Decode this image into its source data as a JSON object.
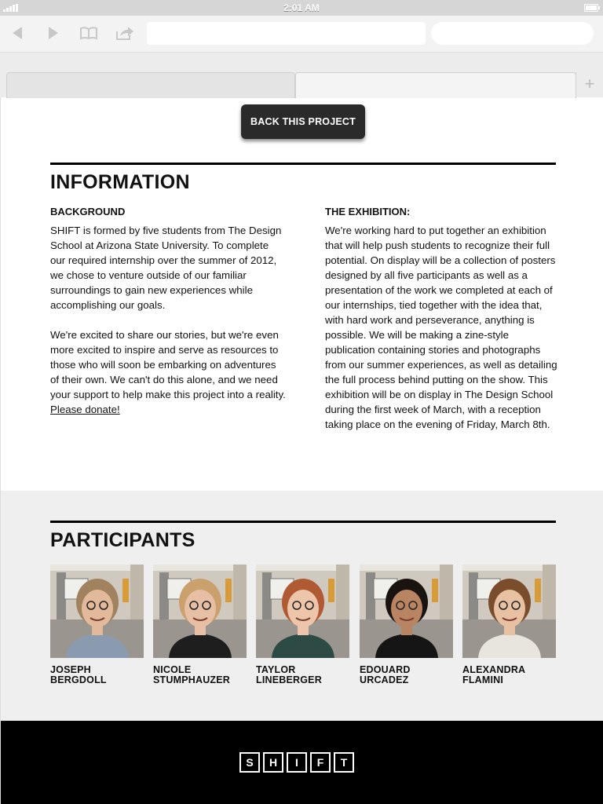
{
  "status_bar": {
    "time": "2:01 AM"
  },
  "toolbar": {
    "back_icon": "back-arrow-icon",
    "forward_icon": "forward-arrow-icon",
    "bookmarks_icon": "book-icon",
    "share_icon": "share-icon",
    "url_value": "",
    "search_value": ""
  },
  "tabs": {
    "new_tab_label": "+"
  },
  "back_button": {
    "label": "BACK THIS PROJECT"
  },
  "information": {
    "heading": "INFORMATION",
    "background": {
      "title": "BACKGROUND",
      "p1": "SHIFT is formed by five students from The Design School at Arizona State University. To complete our required internship over the summer of 2012, we chose to venture outside of our familiar surroundings to gain new experiences while accomplishing our goals.",
      "p2": "We're excited to share our stories, but we're even more excited to inspire and serve as resources to those who will soon be embarking on adventures of their own. We can't do this alone, and we need your support to help make this project into a reality.",
      "link": "Please donate!"
    },
    "exhibition": {
      "title": "THE EXHIBITION:",
      "p1": "We're working hard to put together an exhibition that will help push students to recognize their full potential. On display will be a collection of posters designed by all five participants as well as a presentation of the work we completed at each of our internships, tied together with the idea that, with hard work and perseverance, anything is possible. We will be making a zine-style publication containing stories and photographs from our summer experiences, as well as detailing the full process behind putting on the show. This exhibition will be on display in The Design School during the first week of March, with a reception taking place on the evening of Friday, March 8th."
    }
  },
  "participants": {
    "heading": "PARTICIPANTS",
    "people": [
      {
        "first": "JOSEPH",
        "last": "BERGDOLL",
        "shirt": "#8a9bb0",
        "hair": "#a0825e",
        "skin": "#e2b99a"
      },
      {
        "first": "NICOLE",
        "last": "STUMPHAUZER",
        "shirt": "#1e1e1e",
        "hair": "#caa06c",
        "skin": "#e6bfa4"
      },
      {
        "first": "TAYLOR",
        "last": "LINEBERGER",
        "shirt": "#2e4a44",
        "hair": "#b05a34",
        "skin": "#ecc5aa"
      },
      {
        "first": "EDOUARD",
        "last": "URCADEZ",
        "shirt": "#151515",
        "hair": "#1a1410",
        "skin": "#b98462"
      },
      {
        "first": "ALEXANDRA",
        "last": "FLAMINI",
        "shirt": "#e8e4de",
        "hair": "#7a4e2c",
        "skin": "#e8c0a2"
      }
    ]
  },
  "footer": {
    "logo_letters": [
      "S",
      "H",
      "I",
      "F",
      "T"
    ]
  }
}
